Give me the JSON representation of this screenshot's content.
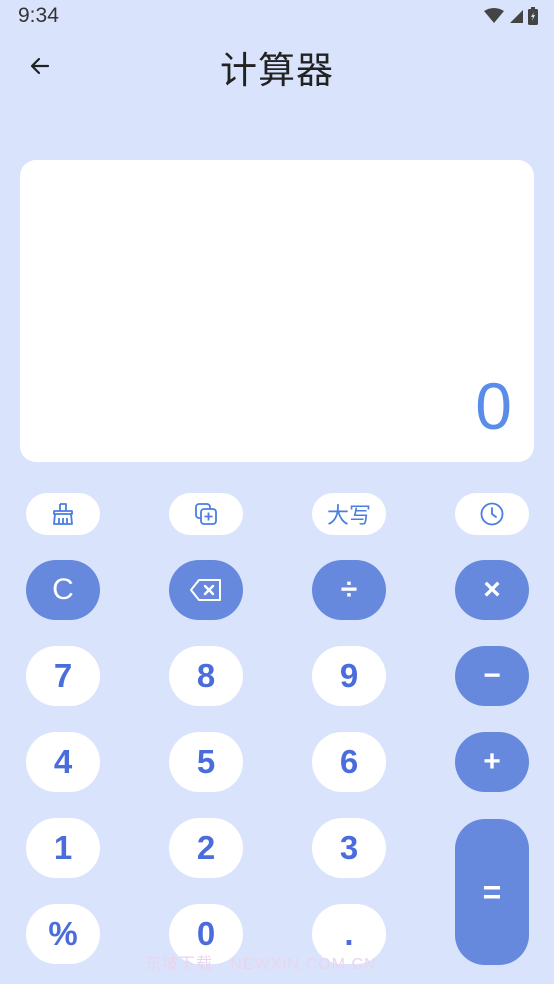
{
  "status_bar": {
    "time": "9:34"
  },
  "header": {
    "title": "计算器"
  },
  "display": {
    "value": "0"
  },
  "tools": {
    "case_label": "大写"
  },
  "keys": {
    "clear": "C",
    "divide": "÷",
    "multiply": "×",
    "minus": "−",
    "plus": "+",
    "equals": "=",
    "percent": "%",
    "dot": ".",
    "d0": "0",
    "d1": "1",
    "d2": "2",
    "d3": "3",
    "d4": "4",
    "d5": "5",
    "d6": "6",
    "d7": "7",
    "d8": "8",
    "d9": "9"
  },
  "watermark": "东坡下载 · NEWXIN.COM.CN"
}
